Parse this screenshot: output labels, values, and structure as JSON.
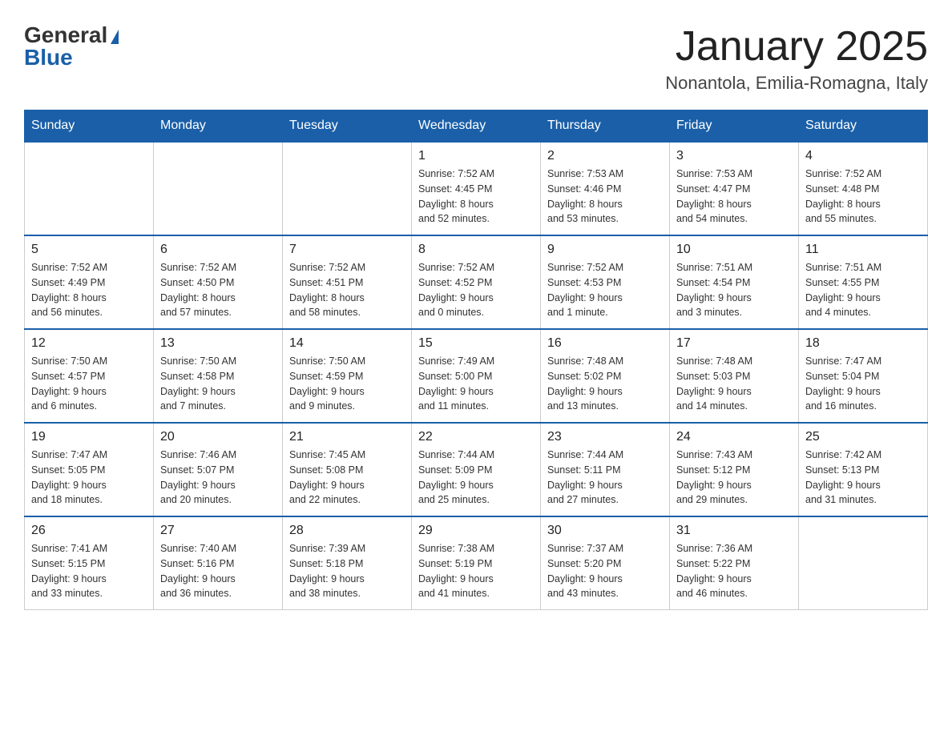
{
  "header": {
    "logo_general": "General",
    "logo_blue": "Blue",
    "month_title": "January 2025",
    "location": "Nonantola, Emilia-Romagna, Italy"
  },
  "days_of_week": [
    "Sunday",
    "Monday",
    "Tuesday",
    "Wednesday",
    "Thursday",
    "Friday",
    "Saturday"
  ],
  "weeks": [
    [
      {
        "day": "",
        "info": ""
      },
      {
        "day": "",
        "info": ""
      },
      {
        "day": "",
        "info": ""
      },
      {
        "day": "1",
        "info": "Sunrise: 7:52 AM\nSunset: 4:45 PM\nDaylight: 8 hours\nand 52 minutes."
      },
      {
        "day": "2",
        "info": "Sunrise: 7:53 AM\nSunset: 4:46 PM\nDaylight: 8 hours\nand 53 minutes."
      },
      {
        "day": "3",
        "info": "Sunrise: 7:53 AM\nSunset: 4:47 PM\nDaylight: 8 hours\nand 54 minutes."
      },
      {
        "day": "4",
        "info": "Sunrise: 7:52 AM\nSunset: 4:48 PM\nDaylight: 8 hours\nand 55 minutes."
      }
    ],
    [
      {
        "day": "5",
        "info": "Sunrise: 7:52 AM\nSunset: 4:49 PM\nDaylight: 8 hours\nand 56 minutes."
      },
      {
        "day": "6",
        "info": "Sunrise: 7:52 AM\nSunset: 4:50 PM\nDaylight: 8 hours\nand 57 minutes."
      },
      {
        "day": "7",
        "info": "Sunrise: 7:52 AM\nSunset: 4:51 PM\nDaylight: 8 hours\nand 58 minutes."
      },
      {
        "day": "8",
        "info": "Sunrise: 7:52 AM\nSunset: 4:52 PM\nDaylight: 9 hours\nand 0 minutes."
      },
      {
        "day": "9",
        "info": "Sunrise: 7:52 AM\nSunset: 4:53 PM\nDaylight: 9 hours\nand 1 minute."
      },
      {
        "day": "10",
        "info": "Sunrise: 7:51 AM\nSunset: 4:54 PM\nDaylight: 9 hours\nand 3 minutes."
      },
      {
        "day": "11",
        "info": "Sunrise: 7:51 AM\nSunset: 4:55 PM\nDaylight: 9 hours\nand 4 minutes."
      }
    ],
    [
      {
        "day": "12",
        "info": "Sunrise: 7:50 AM\nSunset: 4:57 PM\nDaylight: 9 hours\nand 6 minutes."
      },
      {
        "day": "13",
        "info": "Sunrise: 7:50 AM\nSunset: 4:58 PM\nDaylight: 9 hours\nand 7 minutes."
      },
      {
        "day": "14",
        "info": "Sunrise: 7:50 AM\nSunset: 4:59 PM\nDaylight: 9 hours\nand 9 minutes."
      },
      {
        "day": "15",
        "info": "Sunrise: 7:49 AM\nSunset: 5:00 PM\nDaylight: 9 hours\nand 11 minutes."
      },
      {
        "day": "16",
        "info": "Sunrise: 7:48 AM\nSunset: 5:02 PM\nDaylight: 9 hours\nand 13 minutes."
      },
      {
        "day": "17",
        "info": "Sunrise: 7:48 AM\nSunset: 5:03 PM\nDaylight: 9 hours\nand 14 minutes."
      },
      {
        "day": "18",
        "info": "Sunrise: 7:47 AM\nSunset: 5:04 PM\nDaylight: 9 hours\nand 16 minutes."
      }
    ],
    [
      {
        "day": "19",
        "info": "Sunrise: 7:47 AM\nSunset: 5:05 PM\nDaylight: 9 hours\nand 18 minutes."
      },
      {
        "day": "20",
        "info": "Sunrise: 7:46 AM\nSunset: 5:07 PM\nDaylight: 9 hours\nand 20 minutes."
      },
      {
        "day": "21",
        "info": "Sunrise: 7:45 AM\nSunset: 5:08 PM\nDaylight: 9 hours\nand 22 minutes."
      },
      {
        "day": "22",
        "info": "Sunrise: 7:44 AM\nSunset: 5:09 PM\nDaylight: 9 hours\nand 25 minutes."
      },
      {
        "day": "23",
        "info": "Sunrise: 7:44 AM\nSunset: 5:11 PM\nDaylight: 9 hours\nand 27 minutes."
      },
      {
        "day": "24",
        "info": "Sunrise: 7:43 AM\nSunset: 5:12 PM\nDaylight: 9 hours\nand 29 minutes."
      },
      {
        "day": "25",
        "info": "Sunrise: 7:42 AM\nSunset: 5:13 PM\nDaylight: 9 hours\nand 31 minutes."
      }
    ],
    [
      {
        "day": "26",
        "info": "Sunrise: 7:41 AM\nSunset: 5:15 PM\nDaylight: 9 hours\nand 33 minutes."
      },
      {
        "day": "27",
        "info": "Sunrise: 7:40 AM\nSunset: 5:16 PM\nDaylight: 9 hours\nand 36 minutes."
      },
      {
        "day": "28",
        "info": "Sunrise: 7:39 AM\nSunset: 5:18 PM\nDaylight: 9 hours\nand 38 minutes."
      },
      {
        "day": "29",
        "info": "Sunrise: 7:38 AM\nSunset: 5:19 PM\nDaylight: 9 hours\nand 41 minutes."
      },
      {
        "day": "30",
        "info": "Sunrise: 7:37 AM\nSunset: 5:20 PM\nDaylight: 9 hours\nand 43 minutes."
      },
      {
        "day": "31",
        "info": "Sunrise: 7:36 AM\nSunset: 5:22 PM\nDaylight: 9 hours\nand 46 minutes."
      },
      {
        "day": "",
        "info": ""
      }
    ]
  ]
}
